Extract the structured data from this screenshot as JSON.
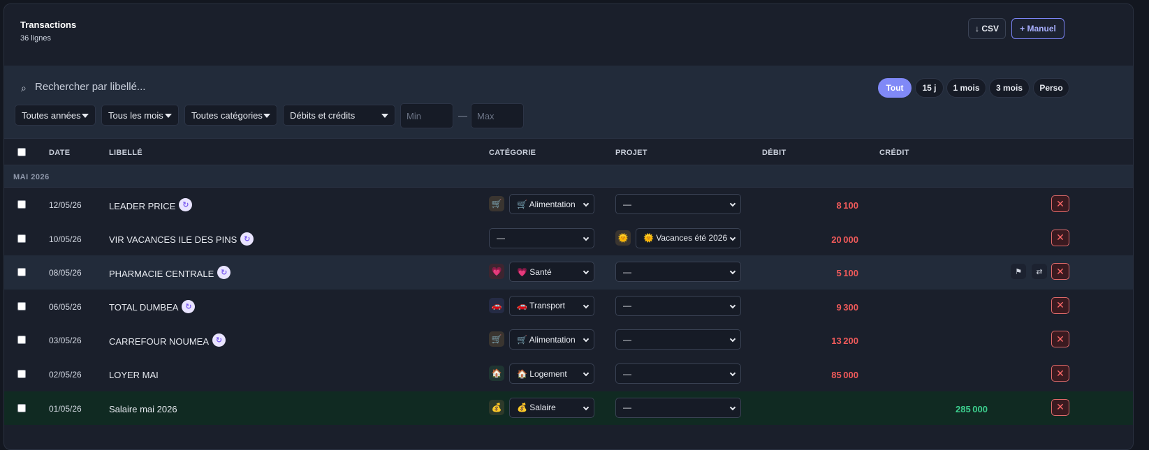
{
  "header": {
    "title": "Transactions",
    "subtitle": "36 lignes",
    "csv_label": "↓ CSV",
    "manual_label": "+ Manuel"
  },
  "filters": {
    "search_placeholder": "Rechercher par libellé...",
    "periods": [
      "Tout",
      "15 j",
      "1 mois",
      "3 mois",
      "Perso"
    ],
    "active_period": "Tout",
    "year": "Toutes années",
    "month": "Tous les mois",
    "category": "Toutes catégories",
    "type": "Débits et crédits",
    "min_placeholder": "Min",
    "max_placeholder": "Max",
    "range_separator": "—"
  },
  "table": {
    "headers": {
      "date": "DATE",
      "label": "LIBELLÉ",
      "category": "CATÉGORIE",
      "project": "PROJET",
      "debit": "DÉBIT",
      "credit": "CRÉDIT"
    },
    "group_label": "MAI 2026",
    "rows": [
      {
        "date": "12/05/26",
        "label": "LEADER PRICE",
        "recurring": true,
        "cat_icon": "🛒",
        "category": "🛒 Alimentation",
        "project_icon": "",
        "project": "—",
        "debit": "8100",
        "credit": ""
      },
      {
        "date": "10/05/26",
        "label": "VIR VACANCES ILE DES PINS",
        "recurring": true,
        "cat_icon": "",
        "category": "—",
        "project_icon": "🌞",
        "project": "🌞 Vacances été 2026",
        "debit": "20000",
        "credit": ""
      },
      {
        "date": "08/05/26",
        "label": "PHARMACIE CENTRALE",
        "recurring": true,
        "cat_icon": "💗",
        "category": "💗 Santé",
        "project_icon": "",
        "project": "—",
        "debit": "5100",
        "credit": ""
      },
      {
        "date": "06/05/26",
        "label": "TOTAL DUMBEA",
        "recurring": true,
        "cat_icon": "🚗",
        "category": "🚗 Transport",
        "project_icon": "",
        "project": "—",
        "debit": "9300",
        "credit": ""
      },
      {
        "date": "03/05/26",
        "label": "CARREFOUR NOUMEA",
        "recurring": true,
        "cat_icon": "🛒",
        "category": "🛒 Alimentation",
        "project_icon": "",
        "project": "—",
        "debit": "13200",
        "credit": ""
      },
      {
        "date": "02/05/26",
        "label": "LOYER MAI",
        "recurring": false,
        "cat_icon": "🏠",
        "category": "🏠 Logement",
        "project_icon": "",
        "project": "—",
        "debit": "85000",
        "credit": ""
      },
      {
        "date": "01/05/26",
        "label": "Salaire mai 2026",
        "recurring": false,
        "cat_icon": "💰",
        "category": "💰 Salaire",
        "project_icon": "",
        "project": "—",
        "debit": "",
        "credit": "285000"
      }
    ],
    "icons": {
      "recurring": "↻",
      "delete": "✕",
      "flag": "⚑",
      "transfer": "⇄"
    },
    "colors": {
      "debit": "#ef5a5a",
      "credit": "#3ccf8e",
      "accent": "#8089f7"
    }
  }
}
